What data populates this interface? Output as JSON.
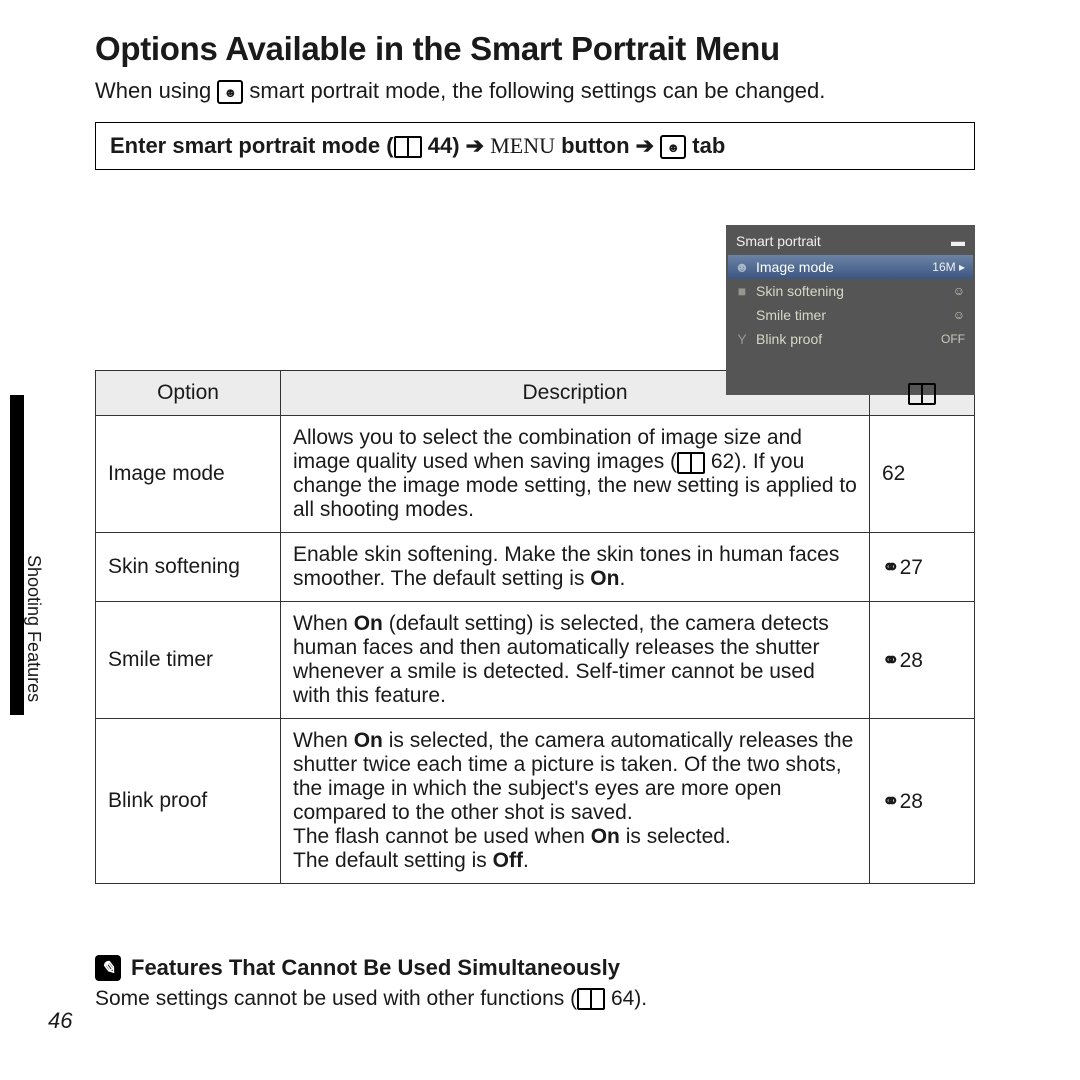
{
  "title": "Options Available in the Smart Portrait Menu",
  "intro_a": "When using ",
  "intro_b": " smart portrait mode, the following settings can be changed.",
  "nav": {
    "a": "Enter smart portrait mode (",
    "ref": " 44) ",
    "menu": "MENU",
    "b": " button ",
    "tab": " tab"
  },
  "cam": {
    "title": "Smart portrait",
    "rows": [
      {
        "label": "Image mode",
        "val": "16M ▸"
      },
      {
        "label": "Skin softening",
        "val": "☺"
      },
      {
        "label": "Smile timer",
        "val": "☺"
      },
      {
        "label": "Blink proof",
        "val": "OFF"
      }
    ]
  },
  "table": {
    "h1": "Option",
    "h2": "Description",
    "rows": [
      {
        "opt": "Image mode",
        "desc_a": "Allows you to select the combination of image size and image quality used when saving images (",
        "desc_b": " 62). If you change the image mode setting, the new setting is applied to all shooting modes.",
        "ref": "62",
        "ref_icon": ""
      },
      {
        "opt": "Skin softening",
        "desc_a": "Enable skin softening. Make the skin tones in human faces smoother. The default setting is ",
        "bold1": "On",
        "desc_b": ".",
        "ref": "27",
        "ref_icon": "link"
      },
      {
        "opt": "Smile timer",
        "desc_a": "When ",
        "bold1": "On",
        "desc_b": " (default setting) is selected, the camera detects human faces and then automatically releases the shutter whenever a smile is detected. Self-timer cannot be used with this feature.",
        "ref": "28",
        "ref_icon": "link"
      },
      {
        "opt": "Blink proof",
        "desc_a": "When ",
        "bold1": "On",
        "desc_b": " is selected, the camera automatically releases the shutter twice each time a picture is taken. Of the two shots, the image in which the subject's eyes are more open compared to the other shot is saved.",
        "desc_c": "The flash cannot be used when ",
        "bold2": "On",
        "desc_d": " is selected.",
        "desc_e": "The default setting is ",
        "bold3": "Off",
        "desc_f": ".",
        "ref": "28",
        "ref_icon": "link"
      }
    ]
  },
  "side": "Shooting Features",
  "note": {
    "title": "Features That Cannot Be Used Simultaneously",
    "body_a": "Some settings cannot be used with other functions (",
    "body_b": " 64)."
  },
  "page_num": "46"
}
